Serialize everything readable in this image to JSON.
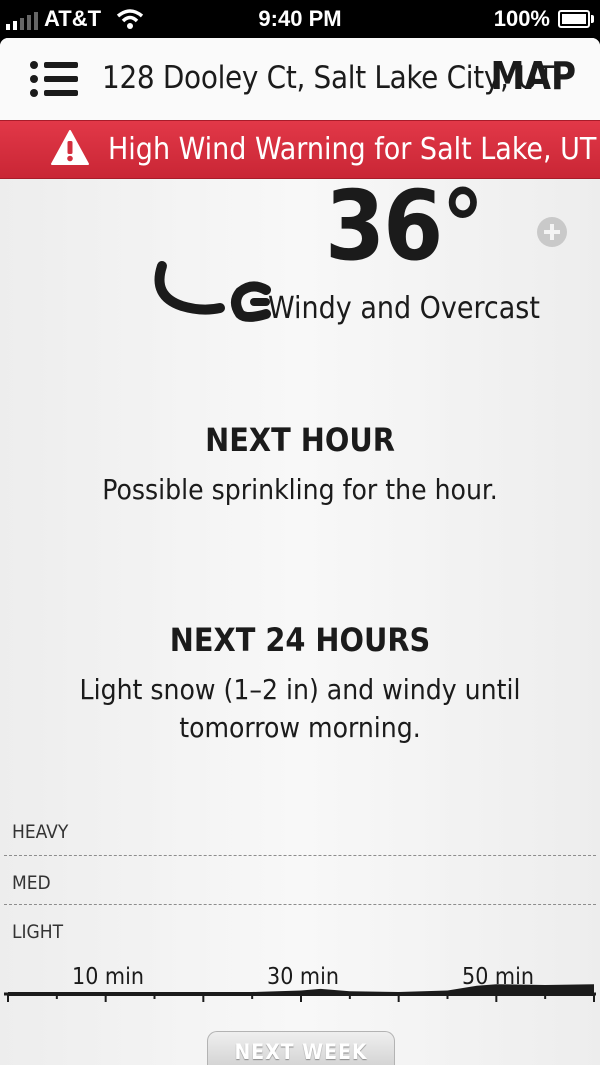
{
  "status_bar": {
    "carrier": "AT&T",
    "time": "9:40 PM",
    "battery": "100%"
  },
  "header": {
    "address": "128 Dooley Ct, Salt Lake City, UT",
    "map_label": "MAP"
  },
  "alert": {
    "text": "High Wind Warning for Salt Lake, UT"
  },
  "current": {
    "temperature": "36°",
    "condition": "Windy and Overcast",
    "icon": "wind-icon"
  },
  "next_hour": {
    "title": "NEXT HOUR",
    "summary": "Possible sprinkling for the hour."
  },
  "next_24": {
    "title": "NEXT 24 HOURS",
    "summary": "Light snow (1–2 in) and windy until tomorrow morning."
  },
  "chart_data": {
    "type": "area",
    "intensity_levels": [
      "HEAVY",
      "MED",
      "LIGHT"
    ],
    "x_tick_labels": [
      "10 min",
      "30 min",
      "50 min"
    ],
    "x_range": [
      0,
      60
    ],
    "x": [
      0,
      5,
      10,
      15,
      20,
      25,
      30,
      32,
      35,
      40,
      45,
      48,
      50,
      55,
      60
    ],
    "y": [
      0,
      0,
      0,
      0,
      0,
      0,
      0.01,
      0.02,
      0.005,
      0,
      0.01,
      0.04,
      0.05,
      0.045,
      0.05
    ],
    "y_range": [
      0,
      1
    ],
    "grid": "dashed horizontal lines at level boundaries"
  },
  "footer": {
    "next_week_label": "NEXT WEEK"
  },
  "colors": {
    "alert_red": "#d32f3e",
    "text_dark": "#1b1b1b"
  }
}
